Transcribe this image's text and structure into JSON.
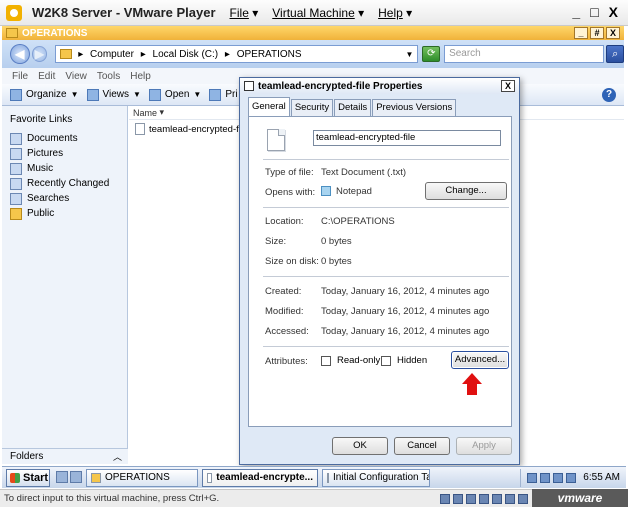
{
  "vmware": {
    "app_title": "W2K8 Server - VMware Player",
    "menu": {
      "file": "File",
      "vm": "Virtual Machine",
      "help": "Help"
    },
    "controls": {
      "minimize": "_",
      "maximize": "□",
      "close": "X"
    },
    "status_text": "To direct input to this virtual machine, press Ctrl+G.",
    "brand": "vmware"
  },
  "explorer": {
    "title": "OPERATIONS",
    "controls": {
      "minimize": "_",
      "maximize": "#",
      "close": "X"
    },
    "breadcrumb": [
      "Computer",
      "Local Disk (C:)",
      "OPERATIONS"
    ],
    "search_placeholder": "Search",
    "menu": [
      "File",
      "Edit",
      "View",
      "Tools",
      "Help"
    ],
    "toolbar": {
      "organize": "Organize",
      "views": "Views",
      "open": "Open",
      "print": "Pri"
    },
    "favorite_links_title": "Favorite Links",
    "favorite_links": [
      "Documents",
      "Pictures",
      "Music",
      "Recently Changed",
      "Searches",
      "Public"
    ],
    "folders_label": "Folders",
    "column_name": "Name",
    "files": [
      "teamlead-encrypted-file"
    ]
  },
  "dialog": {
    "title": "teamlead-encrypted-file Properties",
    "close": "X",
    "tabs": [
      "General",
      "Security",
      "Details",
      "Previous Versions"
    ],
    "active_tab": "General",
    "file_name": "teamlead-encrypted-file",
    "type_label": "Type of file:",
    "type_value": "Text Document (.txt)",
    "opens_label": "Opens with:",
    "opens_value": "Notepad",
    "change_button": "Change...",
    "location_label": "Location:",
    "location_value": "C:\\OPERATIONS",
    "size_label": "Size:",
    "size_value": "0 bytes",
    "size_disk_label": "Size on disk:",
    "size_disk_value": "0 bytes",
    "created_label": "Created:",
    "created_value": "Today, January 16, 2012, 4 minutes ago",
    "modified_label": "Modified:",
    "modified_value": "Today, January 16, 2012, 4 minutes ago",
    "accessed_label": "Accessed:",
    "accessed_value": "Today, January 16, 2012, 4 minutes ago",
    "attributes_label": "Attributes:",
    "readonly_label": "Read-only",
    "hidden_label": "Hidden",
    "advanced_button": "Advanced...",
    "ok_button": "OK",
    "cancel_button": "Cancel",
    "apply_button": "Apply"
  },
  "taskbar": {
    "start": "Start",
    "tasks": [
      "OPERATIONS",
      "teamlead-encrypte...",
      "Initial Configuration Tasks"
    ],
    "active_task": "teamlead-encrypte...",
    "clock": "6:55 AM"
  }
}
